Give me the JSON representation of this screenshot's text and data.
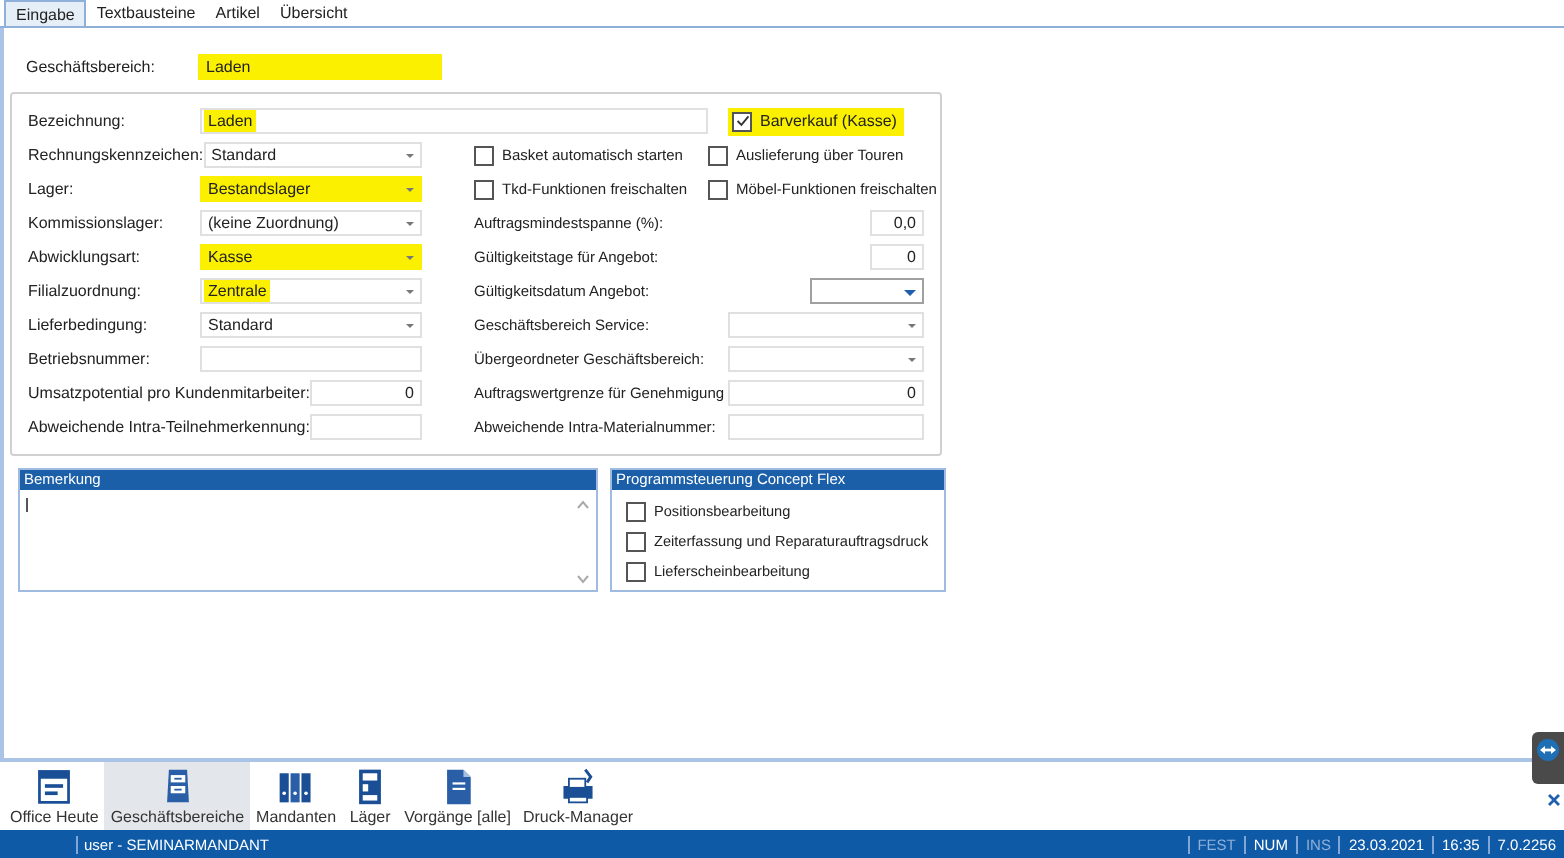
{
  "tabs": [
    {
      "label": "Eingabe",
      "selected": true
    },
    {
      "label": "Textbausteine",
      "selected": false
    },
    {
      "label": "Artikel",
      "selected": false
    },
    {
      "label": "Übersicht",
      "selected": false
    }
  ],
  "business_area": {
    "label": "Geschäftsbereich:",
    "value": "Laden",
    "highlighted": true,
    "full_width": true
  },
  "designation": {
    "label": "Bezeichnung:",
    "value": "Laden",
    "highlighted": true,
    "full_width": false
  },
  "cash_sale": {
    "label": "Barverkauf (Kasse)",
    "checked": true,
    "highlighted": true
  },
  "left_fields": [
    {
      "label": "Rechnungskennzeichen:",
      "kind": "dropdown",
      "value": "Standard",
      "highlighted": false
    },
    {
      "label": "Lager:",
      "kind": "dropdown",
      "value": "Bestandslager",
      "highlighted": true,
      "full_width": true
    },
    {
      "label": "Kommissionslager:",
      "kind": "dropdown",
      "value": "(keine Zuordnung)",
      "highlighted": false
    },
    {
      "label": "Abwicklungsart:",
      "kind": "dropdown",
      "value": "Kasse",
      "highlighted": true,
      "full_width": true
    },
    {
      "label": "Filialzuordnung:",
      "kind": "dropdown",
      "value": "Zentrale",
      "highlighted": true,
      "full_width": false
    },
    {
      "label": "Lieferbedingung:",
      "kind": "dropdown",
      "value": "Standard",
      "highlighted": false
    },
    {
      "label": "Betriebsnummer:",
      "kind": "text"
    },
    {
      "label": "Umsatzpotential pro Kundenmitarbeiter:",
      "kind": "number",
      "value": "0",
      "highlighted": false
    },
    {
      "label": "Abweichende Intra-Teilnehmerkennung:",
      "kind": "text"
    }
  ],
  "options": [
    {
      "label": "Basket automatisch starten",
      "checked": false
    },
    {
      "label": "Auslieferung über Touren",
      "checked": false
    },
    {
      "label": "Tkd-Funktionen freischalten",
      "checked": false
    },
    {
      "label": "Möbel-Funktionen freischalten",
      "checked": false
    }
  ],
  "right_fields": [
    {
      "label": "Auftragsmindestspanne (%):",
      "kind": "number-small",
      "value": "0,0"
    },
    {
      "label": "Gültigkeitstage für Angebot:",
      "kind": "number-small",
      "value": "0"
    },
    {
      "label": "Gültigkeitsdatum Angebot:",
      "kind": "date"
    },
    {
      "label": "Geschäftsbereich Service:",
      "kind": "dropdown"
    },
    {
      "label": "Übergeordneter Geschäftsbereich:",
      "kind": "dropdown"
    },
    {
      "label": "Auftragswertgrenze für Genehmigung",
      "kind": "number",
      "value": "0"
    },
    {
      "label": "Abweichende Intra-Materialnummer:",
      "kind": "text"
    }
  ],
  "remark": {
    "title": "Bemerkung"
  },
  "program_control": {
    "title": "Programmsteuerung Concept Flex",
    "options": [
      {
        "label": "Positionsbearbeitung",
        "checked": false
      },
      {
        "label": "Zeiterfassung und Reparaturauftragsdruck",
        "checked": false
      },
      {
        "label": "Lieferscheinbearbeitung",
        "checked": false
      }
    ]
  },
  "toolbar": [
    {
      "label": "Office Heute",
      "kind": "calendar",
      "selected": false
    },
    {
      "label": "Geschäftsbereiche",
      "kind": "cabinet",
      "selected": true
    },
    {
      "label": "Mandanten",
      "kind": "binders",
      "selected": false
    },
    {
      "label": "Läger",
      "kind": "shelf",
      "selected": false
    },
    {
      "label": "Vorgänge [alle]",
      "kind": "document",
      "selected": false
    },
    {
      "label": "Druck-Manager",
      "kind": "printer",
      "selected": false
    }
  ],
  "status_bar": {
    "user": "user - SEMINARMANDANT",
    "indicators": [
      {
        "label": "FEST",
        "on": false
      },
      {
        "label": "NUM",
        "on": true
      },
      {
        "label": "INS",
        "on": false
      },
      {
        "label": "23.03.2021",
        "on": true
      },
      {
        "label": "16:35",
        "on": true
      },
      {
        "label": "7.0.2256",
        "on": true
      }
    ]
  }
}
